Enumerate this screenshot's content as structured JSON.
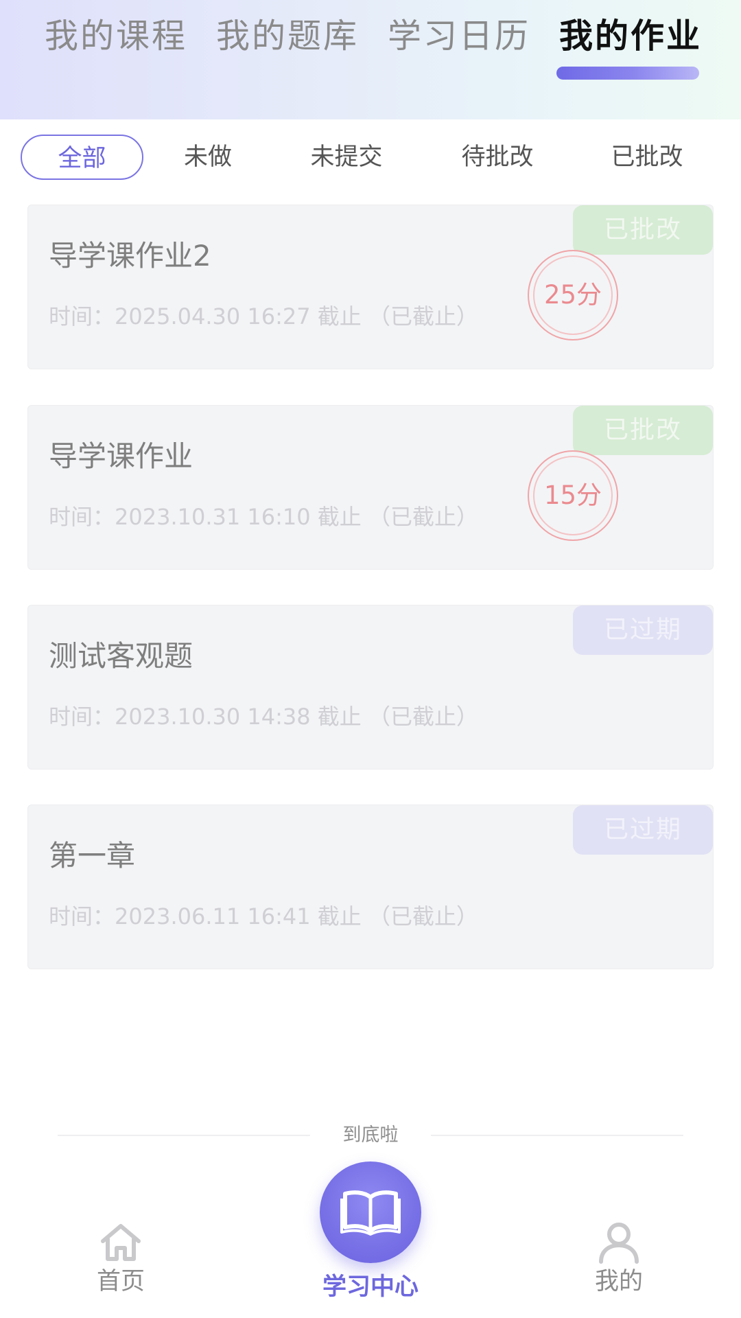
{
  "top_tabs": [
    {
      "label": "我的课程"
    },
    {
      "label": "我的题库"
    },
    {
      "label": "学习日历"
    },
    {
      "label": "我的作业"
    }
  ],
  "active_top_tab": "我的作业",
  "filters": [
    {
      "label": "全部"
    },
    {
      "label": "未做"
    },
    {
      "label": "未提交"
    },
    {
      "label": "待批改"
    },
    {
      "label": "已批改"
    }
  ],
  "active_filter": "全部",
  "assignments": [
    {
      "title": "导学课作业2",
      "time": "时间：2025.04.30 16:27 截止 （已截止）",
      "status": "已批改",
      "score": "25分"
    },
    {
      "title": "导学课作业",
      "time": "时间：2023.10.31 16:10 截止 （已截止）",
      "status": "已批改",
      "score": "15分"
    },
    {
      "title": "测试客观题",
      "time": "时间：2023.10.30 14:38 截止 （已截止）",
      "status": "已过期"
    },
    {
      "title": "第一章",
      "time": "时间：2023.06.11 16:41 截止 （已截止）",
      "status": "已过期"
    }
  ],
  "end_of_list": "到底啦",
  "bottom_nav": {
    "home": "首页",
    "study_center": "学习中心",
    "mine": "我的"
  },
  "colors": {
    "accent": "#6d67de",
    "graded_badge": "#d6ecd4",
    "expired_badge": "#e1e1f5",
    "score": "#ea8a8f"
  },
  "icons": {
    "home": "home-icon",
    "study_center": "open-book-icon",
    "mine": "person-icon"
  }
}
